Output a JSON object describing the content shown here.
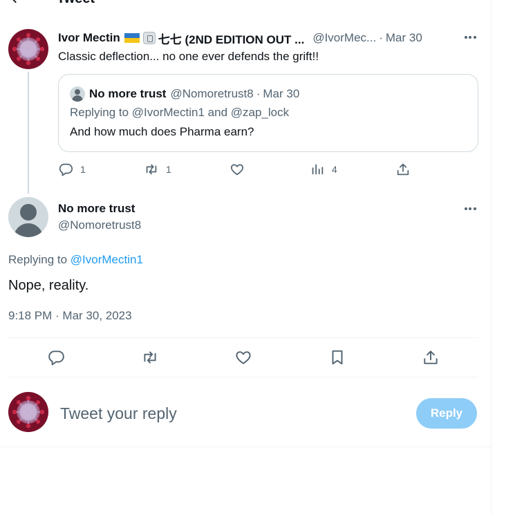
{
  "header": {
    "title": "Tweet"
  },
  "parent_tweet": {
    "display_name": "Ivor Mectin",
    "name_suffix": "七七 (2ND EDITION OUT ...",
    "handle": "@IvorMec...",
    "date": "Mar 30",
    "separator": "·",
    "text": "Classic deflection... no one ever defends the grift!!",
    "quote": {
      "name": "No more trust",
      "handle": "@Nomoretrust8",
      "date": "Mar 30",
      "replying_prefix": "Replying to",
      "replying_user1": "@IvorMectin1",
      "replying_and": "and",
      "replying_user2": "@zap_lock",
      "text": "And how much does Pharma earn?"
    },
    "stats": {
      "replies": "1",
      "retweets": "1",
      "views": "4"
    }
  },
  "main_tweet": {
    "display_name": "No more trust",
    "handle": "@Nomoretrust8",
    "replying_prefix": "Replying to",
    "replying_user": "@IvorMectin1",
    "text": "Nope, reality.",
    "timestamp": "9:18 PM · Mar 30, 2023"
  },
  "compose": {
    "placeholder": "Tweet your reply",
    "reply_button": "Reply"
  },
  "colors": {
    "accent": "#1d9bf0",
    "reply_button_disabled": "#8ecdf8",
    "secondary_text": "#536471",
    "border": "#cfd9de"
  },
  "icons": [
    "back-arrow-icon",
    "more-icon",
    "reply-icon",
    "retweet-icon",
    "like-icon",
    "views-icon",
    "share-icon",
    "bookmark-icon"
  ]
}
